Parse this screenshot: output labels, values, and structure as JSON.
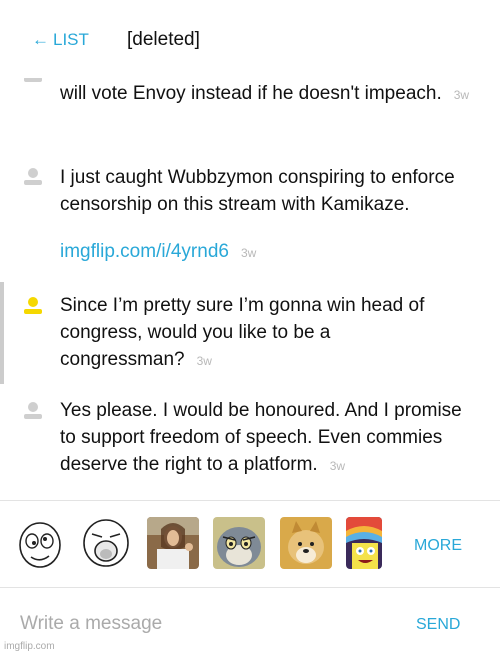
{
  "header": {
    "back_label": "LIST",
    "title": "[deleted]"
  },
  "messages": [
    {
      "text": "will vote Envoy instead if he doesn't impeach.",
      "time": "3w"
    },
    {
      "text": "I just caught Wubbzymon conspiring to enforce censorship on this stream with Kamikaze.",
      "link": "imgflip.com/i/4yrnd6",
      "time": "3w"
    },
    {
      "text": "Since I’m pretty sure I’m gonna win head of congress, would you like to be a congressman?",
      "time": "3w",
      "avatar_color": "#f5d800",
      "selected": true
    },
    {
      "text": "Yes please. I would be honoured. And I promise to support freedom of speech. Even commies deserve the right to a platform.",
      "time": "3w"
    }
  ],
  "stickers": [
    "derp-face",
    "lol-face",
    "buddy-christ",
    "tom-unsettled",
    "doge",
    "imagination-spongebob"
  ],
  "tray": {
    "more_label": "MORE"
  },
  "compose": {
    "placeholder": "Write a message",
    "send_label": "SEND"
  },
  "watermark": "imgflip.com",
  "colors": {
    "accent": "#29a8d8",
    "avatar_default": "#cfcfcf",
    "avatar_active": "#f5d800",
    "timestamp": "#b8b8b8"
  }
}
